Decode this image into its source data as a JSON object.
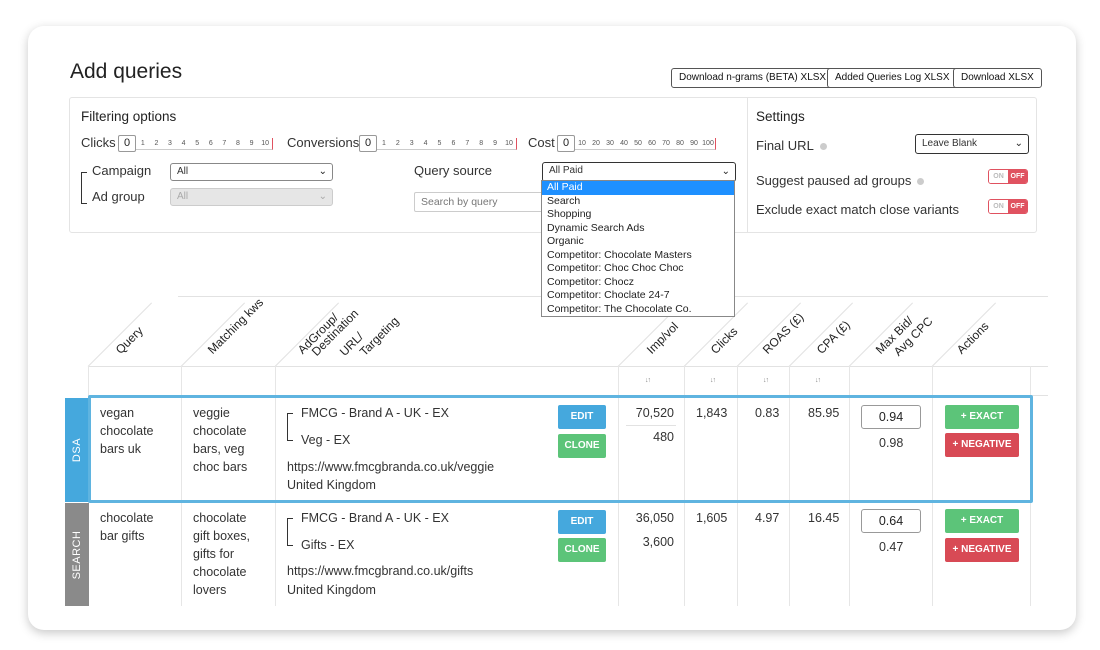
{
  "page_title": "Add queries",
  "downloads": {
    "ngrams": "Download n-grams (BETA) XLSX",
    "log": "Added Queries Log XLSX",
    "xlsx": "Download XLSX"
  },
  "filters": {
    "heading": "Filtering options",
    "clicks": {
      "label": "Clicks",
      "value": "0",
      "ticks": [
        "1",
        "2",
        "3",
        "4",
        "5",
        "6",
        "7",
        "8",
        "9",
        "10"
      ]
    },
    "conversions": {
      "label": "Conversions",
      "value": "0",
      "ticks": [
        "1",
        "2",
        "3",
        "4",
        "5",
        "6",
        "7",
        "8",
        "9",
        "10"
      ]
    },
    "cost": {
      "label": "Cost",
      "value": "0",
      "ticks": [
        "10",
        "20",
        "30",
        "40",
        "50",
        "60",
        "70",
        "80",
        "90",
        "100"
      ]
    },
    "campaign": {
      "label": "Campaign",
      "value": "All"
    },
    "ad_group": {
      "label": "Ad group",
      "value": "All"
    },
    "query_source": {
      "label": "Query source",
      "value": "All Paid",
      "options": [
        "All Paid",
        "Search",
        "Shopping",
        "Dynamic Search Ads",
        "Organic",
        "Competitor: Chocolate Masters",
        "Competitor: Choc Choc Choc",
        "Competitor: Chocz",
        "Competitor: Choclate 24-7",
        "Competitor: The Chocolate Co."
      ]
    },
    "search_placeholder": "Search by query"
  },
  "settings": {
    "heading": "Settings",
    "final_url": {
      "label": "Final URL",
      "value": "Leave Blank"
    },
    "suggest_paused": {
      "label": "Suggest paused ad groups",
      "on": "ON",
      "off": "OFF"
    },
    "exclude_exact": {
      "label": "Exclude exact match close variants",
      "on": "ON",
      "off": "OFF"
    }
  },
  "table": {
    "headers": {
      "query": "Query",
      "matching_kws": "Matching kws",
      "adgroup_1": "AdGroup/",
      "adgroup_2": "Destination",
      "adgroup_3": "URL/",
      "adgroup_4": "Targeting",
      "imp_vol": "Imp/vol",
      "clicks": "Clicks",
      "roas": "ROAS (£)",
      "cpa": "CPA (£)",
      "maxbid_1": "Max Bid/",
      "maxbid_2": "Avg CPC",
      "actions": "Actions"
    },
    "rows": [
      {
        "type": "DSA",
        "query_lines": [
          "vegan",
          "chocolate",
          "bars uk"
        ],
        "kws_lines": [
          "veggie",
          "chocolate",
          "bars, veg",
          "choc bars"
        ],
        "campaign": "FMCG - Brand A - UK - EX",
        "ad_group": "Veg - EX",
        "url": "https://www.fmcgbranda.co.uk/veggie",
        "country": "United Kingdom",
        "imp": "70,520",
        "vol": "480",
        "clicks": "1,843",
        "roas": "0.83",
        "cpa": "85.95",
        "max_bid": "0.94",
        "avg_cpc": "0.98",
        "edit": "EDIT",
        "clone": "CLONE",
        "exact": "+ EXACT",
        "negative": "+ NEGATIVE"
      },
      {
        "type": "SEARCH",
        "query_lines": [
          "chocolate",
          "bar gifts"
        ],
        "kws_lines": [
          "chocolate",
          "gift boxes,",
          "gifts for",
          "chocolate",
          "lovers"
        ],
        "campaign": "FMCG - Brand A - UK - EX",
        "ad_group": "Gifts - EX",
        "url": "https://www.fmcgbrand.co.uk/gifts",
        "country": "United Kingdom",
        "imp": "36,050",
        "vol": "3,600",
        "clicks": "1,605",
        "roas": "4.97",
        "cpa": "16.45",
        "max_bid": "0.64",
        "avg_cpc": "0.47",
        "edit": "EDIT",
        "clone": "CLONE",
        "exact": "+ EXACT",
        "negative": "+ NEGATIVE"
      }
    ]
  },
  "colors": {
    "dsa_band": "#45a8dd",
    "search_band": "#8a8a8a",
    "selection": "#1e90ff",
    "toggle_off": "#e05260"
  }
}
